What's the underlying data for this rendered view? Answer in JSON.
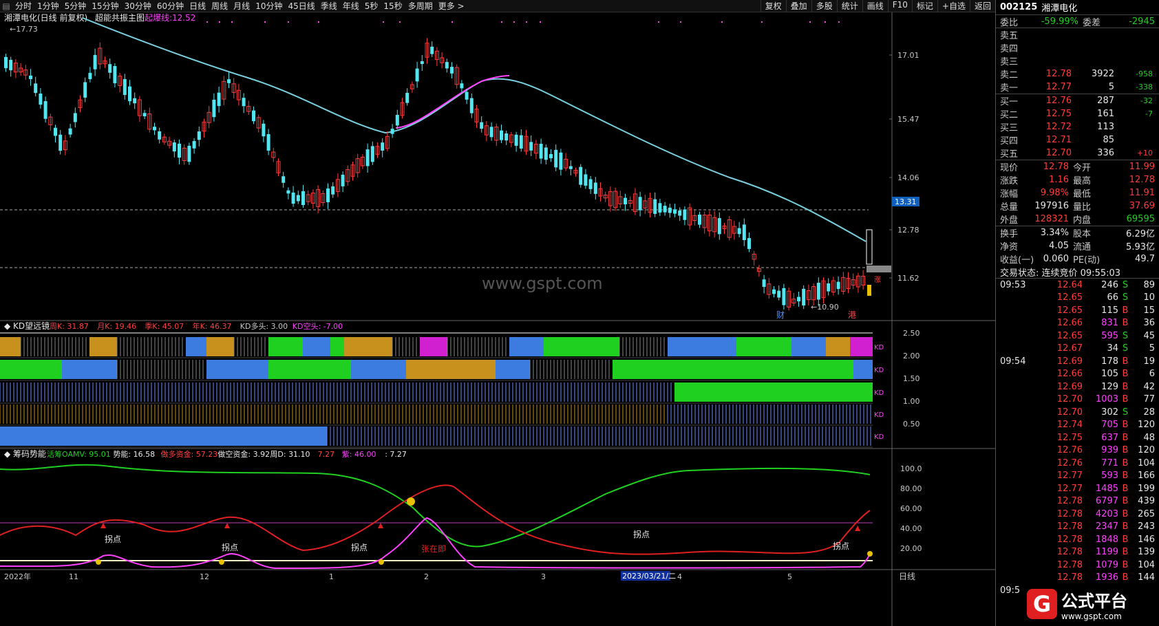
{
  "toolbar": {
    "periods": [
      "分时",
      "1分钟",
      "5分钟",
      "15分钟",
      "30分钟",
      "60分钟",
      "日线",
      "周线",
      "月线",
      "10分钟",
      "45日线",
      "季线",
      "年线",
      "5秒",
      "15秒",
      "多周期",
      "更多 >"
    ],
    "tools": [
      "复权",
      "叠加",
      "多股",
      "统计",
      "画线",
      "F10",
      "标记",
      "+自选",
      "返回"
    ]
  },
  "chart_header": {
    "stock": "湘潭电化(日线 前复权)",
    "indicator": "超能共振主图",
    "line_label": "起爆线:",
    "line_value": "12.52"
  },
  "price_axis": {
    "ticks": [
      "17.01",
      "15.47",
      "14.06",
      "12.78",
      "11.62"
    ],
    "highlight": "13.31",
    "high_label": "17.73",
    "low_label": "10.90",
    "marker_cai": "财",
    "marker_gang": "港",
    "right_marker": "涨"
  },
  "watermark": "www.gspt.com",
  "kd_panel": {
    "title": "KD望远镜",
    "items": [
      {
        "label": "周K: 31.87",
        "color": "#ff4040"
      },
      {
        "label": "月K: 19.46",
        "color": "#ff4040"
      },
      {
        "label": "季K: 45.07",
        "color": "#ff4040"
      },
      {
        "label": "年K: 46.37",
        "color": "#ff4040"
      },
      {
        "label": "KD多头: 3.00",
        "color": "#c8c8c8"
      },
      {
        "label": "KD空头: -7.00",
        "color": "#ff40ff"
      }
    ],
    "axis": [
      "2.50",
      "2.00",
      "1.50",
      "1.00",
      "0.50"
    ],
    "row_label": "KD"
  },
  "chip_panel": {
    "title": "筹码势能",
    "items": [
      {
        "label": "活筹OAMV: 95.01",
        "color": "#20d020"
      },
      {
        "label": "势能: 16.58",
        "color": "#e8e8e8"
      },
      {
        "label": "做多资金: 57.23",
        "color": "#ff4040"
      },
      {
        "label": "做空资金: 3.92",
        "color": "#e8e8e8"
      },
      {
        "label": "周D: 31.10",
        "color": "#e8e8e8"
      },
      {
        "label": "7.27",
        "color": "#ff4040"
      },
      {
        "label": "紫: 46.00",
        "color": "#ff40ff"
      },
      {
        "label": ": 7.27",
        "color": "#e8e8e8"
      }
    ],
    "axis": [
      "100.0",
      "80.00",
      "60.00",
      "40.00",
      "20.00"
    ],
    "annotations": [
      "拐点",
      "拐点",
      "拐点",
      "张在即",
      "拐点",
      "拐点"
    ]
  },
  "x_axis": {
    "labels": [
      "2022年",
      "11",
      "12",
      "1",
      "2",
      "3",
      "4",
      "5"
    ],
    "highlight_date": "2023/03/21/二",
    "period": "日线"
  },
  "quote": {
    "code": "002125",
    "name": "湘潭电化",
    "weibi_label": "委比",
    "weibi": "-59.99%",
    "weicha_label": "委差",
    "weicha": "-2945",
    "sell": [
      {
        "label": "卖五",
        "price": "",
        "vol": "",
        "chg": ""
      },
      {
        "label": "卖四",
        "price": "",
        "vol": "",
        "chg": ""
      },
      {
        "label": "卖三",
        "price": "",
        "vol": "",
        "chg": ""
      },
      {
        "label": "卖二",
        "price": "12.78",
        "vol": "3922",
        "chg": "-958"
      },
      {
        "label": "卖一",
        "price": "12.77",
        "vol": "5",
        "chg": "-338"
      }
    ],
    "buy": [
      {
        "label": "买一",
        "price": "12.76",
        "vol": "287",
        "chg": "-32"
      },
      {
        "label": "买二",
        "price": "12.75",
        "vol": "161",
        "chg": "-7"
      },
      {
        "label": "买三",
        "price": "12.72",
        "vol": "113",
        "chg": ""
      },
      {
        "label": "买四",
        "price": "12.71",
        "vol": "85",
        "chg": ""
      },
      {
        "label": "买五",
        "price": "12.70",
        "vol": "336",
        "chg": "+10"
      }
    ],
    "stats": [
      {
        "l1": "现价",
        "v1": "12.78",
        "c1": "red",
        "l2": "今开",
        "v2": "11.99",
        "c2": "red"
      },
      {
        "l1": "涨跌",
        "v1": "1.16",
        "c1": "red",
        "l2": "最高",
        "v2": "12.78",
        "c2": "red"
      },
      {
        "l1": "涨幅",
        "v1": "9.98%",
        "c1": "red",
        "l2": "最低",
        "v2": "11.91",
        "c2": "red"
      },
      {
        "l1": "总量",
        "v1": "197916",
        "c1": "white",
        "l2": "量比",
        "v2": "37.69",
        "c2": "red"
      },
      {
        "l1": "外盘",
        "v1": "128321",
        "c1": "red",
        "l2": "内盘",
        "v2": "69595",
        "c2": "green"
      }
    ],
    "stats2": [
      {
        "l1": "换手",
        "v1": "3.34%",
        "l2": "股本",
        "v2": "6.29亿"
      },
      {
        "l1": "净资",
        "v1": "4.05",
        "l2": "流通",
        "v2": "5.93亿"
      },
      {
        "l1": "收益(一)",
        "v1": "0.060",
        "l2": "PE(动)",
        "v2": "49.7"
      }
    ],
    "trade_status": "交易状态: 连续竞价 09:55:03"
  },
  "ticks": [
    {
      "t": "09:53",
      "p": "12.64",
      "v": "246",
      "s": "S",
      "n": "89"
    },
    {
      "t": "",
      "p": "12.65",
      "v": "66",
      "s": "S",
      "n": "10"
    },
    {
      "t": "",
      "p": "12.65",
      "v": "115",
      "s": "B",
      "n": "15"
    },
    {
      "t": "",
      "p": "12.66",
      "v": "831",
      "s": "B",
      "n": "36"
    },
    {
      "t": "",
      "p": "12.65",
      "v": "595",
      "s": "S",
      "n": "45"
    },
    {
      "t": "",
      "p": "12.67",
      "v": "34",
      "s": "S",
      "n": "5"
    },
    {
      "t": "09:54",
      "p": "12.69",
      "v": "178",
      "s": "B",
      "n": "19"
    },
    {
      "t": "",
      "p": "12.66",
      "v": "105",
      "s": "B",
      "n": "6"
    },
    {
      "t": "",
      "p": "12.69",
      "v": "129",
      "s": "B",
      "n": "42"
    },
    {
      "t": "",
      "p": "12.70",
      "v": "1003",
      "s": "B",
      "n": "77"
    },
    {
      "t": "",
      "p": "12.70",
      "v": "302",
      "s": "S",
      "n": "28"
    },
    {
      "t": "",
      "p": "12.74",
      "v": "705",
      "s": "B",
      "n": "120"
    },
    {
      "t": "",
      "p": "12.75",
      "v": "637",
      "s": "B",
      "n": "48"
    },
    {
      "t": "",
      "p": "12.76",
      "v": "939",
      "s": "B",
      "n": "120"
    },
    {
      "t": "",
      "p": "12.76",
      "v": "771",
      "s": "B",
      "n": "104"
    },
    {
      "t": "",
      "p": "12.77",
      "v": "593",
      "s": "B",
      "n": "166"
    },
    {
      "t": "",
      "p": "12.77",
      "v": "1485",
      "s": "B",
      "n": "199"
    },
    {
      "t": "",
      "p": "12.78",
      "v": "6797",
      "s": "B",
      "n": "439"
    },
    {
      "t": "",
      "p": "12.78",
      "v": "4203",
      "s": "B",
      "n": "265"
    },
    {
      "t": "",
      "p": "12.78",
      "v": "2347",
      "s": "B",
      "n": "243"
    },
    {
      "t": "",
      "p": "12.78",
      "v": "1848",
      "s": "B",
      "n": "146"
    },
    {
      "t": "",
      "p": "12.78",
      "v": "1199",
      "s": "B",
      "n": "139"
    },
    {
      "t": "",
      "p": "12.78",
      "v": "1079",
      "s": "B",
      "n": "104"
    },
    {
      "t": "",
      "p": "12.78",
      "v": "1936",
      "s": "B",
      "n": "144"
    },
    {
      "t": "09:5",
      "p": "",
      "v": "",
      "s": "",
      "n": ""
    }
  ],
  "logo": {
    "glyph": "G",
    "title": "公式平台",
    "url": "www.gspt.com"
  },
  "colors": {
    "up": "#ff3b3b",
    "down": "#54e6f0",
    "ma": "#7ad0e0",
    "ma_hot": "#ff40ff",
    "green": "#20d020",
    "orange": "#c8901c",
    "blue": "#3c7ce0",
    "purple": "#d020d0"
  }
}
